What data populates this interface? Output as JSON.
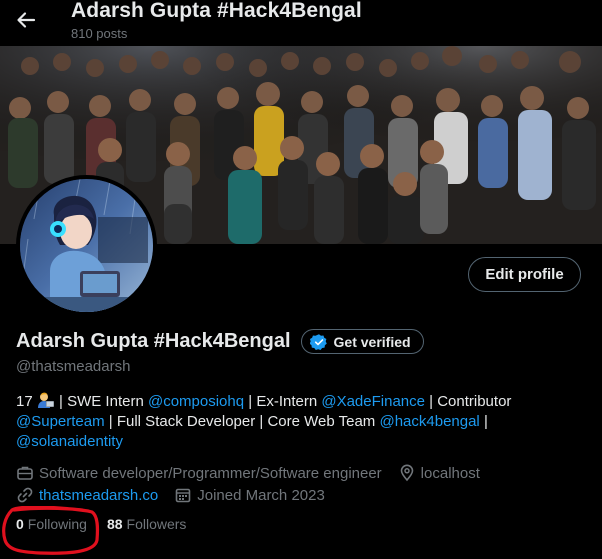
{
  "header": {
    "title": "Adarsh Gupta #Hack4Bengal",
    "posts_count": "810 posts"
  },
  "profile": {
    "display_name": "Adarsh Gupta #Hack4Bengal",
    "handle": "@thatsmeadarsh",
    "get_verified_label": "Get verified",
    "edit_profile_label": "Edit profile",
    "bio": {
      "t1": "17",
      "t2": "| SWE Intern",
      "link1": "@composiohq",
      "t3": "| Ex-Intern",
      "link2": "@XadeFinance",
      "t4": "| Contributor",
      "link3": "@Superteam",
      "t5": "| Full Stack Developer | Core Web Team",
      "link4": "@hack4bengal",
      "t6": "|",
      "link5": "@solanaidentity"
    },
    "category": "Software developer/Programmer/Software engineer",
    "location": "localhost",
    "website": "thatsmeadarsh.co",
    "joined": "Joined March 2023",
    "following_count": "0",
    "following_label": "Following",
    "followers_count": "88",
    "followers_label": "Followers"
  },
  "colors": {
    "background": "#000000",
    "text": "#e7e9ea",
    "muted": "#71767b",
    "link": "#1d9bf0",
    "border": "#536471",
    "annotation": "#e0101e"
  },
  "icons": {
    "back": "arrow-left-icon",
    "verified": "verified-badge-icon",
    "category": "briefcase-icon",
    "location": "location-pin-icon",
    "website": "link-icon",
    "joined": "calendar-icon"
  }
}
